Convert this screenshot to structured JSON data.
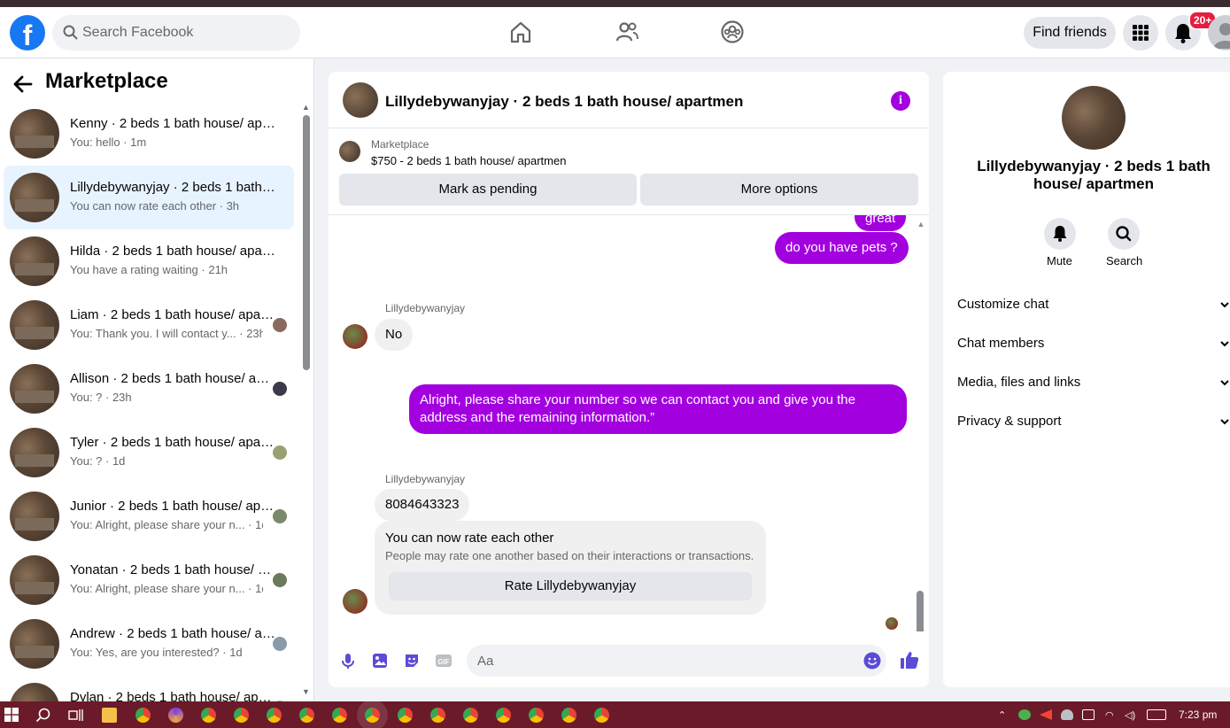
{
  "header": {
    "logo": "facebook-logo",
    "search_placeholder": "Search Facebook",
    "find_friends_label": "Find friends",
    "notification_count": "20+"
  },
  "sidebar": {
    "title": "Marketplace",
    "conversations": [
      {
        "title": "Kenny · 2 beds 1 bath house/ apartmen",
        "subtitle": "You: hello · 1m",
        "active": false,
        "avatar": false
      },
      {
        "title": "Lillydebywanyjay · 2 beds 1 bath house/ apartmen",
        "subtitle": "You can now rate each other · 3h",
        "active": true,
        "avatar": false
      },
      {
        "title": "Hilda · 2 beds 1 bath house/ apartmen",
        "subtitle": "You have a rating waiting · 21h",
        "active": false,
        "avatar": false
      },
      {
        "title": "Liam · 2 beds 1 bath house/ apartmen",
        "subtitle": "You: Thank you. I will contact y...  · 23h",
        "active": false,
        "avatar": true
      },
      {
        "title": "Allison · 2 beds 1 bath house/ apartmen",
        "subtitle": "You: ? · 23h",
        "active": false,
        "avatar": true
      },
      {
        "title": "Tyler · 2 beds 1 bath house/ apartmen",
        "subtitle": "You: ? · 1d",
        "active": false,
        "avatar": true
      },
      {
        "title": "Junior · 2 beds 1 bath house/ apartmen",
        "subtitle": "You: Alright, please share your n... · 1d",
        "active": false,
        "avatar": true
      },
      {
        "title": "Yonatan · 2 beds 1 bath house/ apartmen",
        "subtitle": "You: Alright, please share your n... · 1d",
        "active": false,
        "avatar": true
      },
      {
        "title": "Andrew · 2 beds 1 bath house/ apartmen",
        "subtitle": "You: Yes, are you interested? · 1d",
        "active": false,
        "avatar": true
      },
      {
        "title": "Dylan · 2 beds 1 bath house/ apartmen",
        "subtitle": "",
        "active": false,
        "avatar": true
      }
    ]
  },
  "chat": {
    "title": "Lillydebywanyjay · 2 beds 1 bath house/ apartmen",
    "marketplace_label": "Marketplace",
    "listing": "$750 - 2 beds 1 bath house/ apartmen",
    "mark_pending_label": "Mark as pending",
    "more_options_label": "More options",
    "messages": {
      "partial_out": "great",
      "pets_question": "do you have pets ?",
      "sender_name": "Lillydebywanyjay",
      "reply_no": "No",
      "share_number": "Alright, please share your number so we can contact you and give you the address and the remaining information.”",
      "phone_number": "8084643323"
    },
    "rate_card": {
      "title": "You can now rate each other",
      "description": "People may rate one another based on their interactions or transactions.",
      "button_label": "Rate Lillydebywanyjay"
    },
    "composer_placeholder": "Aa"
  },
  "right_panel": {
    "name": "Lillydebywanyjay · 2 beds 1 bath house/ apartmen",
    "mute_label": "Mute",
    "search_label": "Search",
    "sections": [
      "Customize chat",
      "Chat members",
      "Media, files and links",
      "Privacy & support"
    ]
  },
  "taskbar": {
    "time": "7:23 pm"
  },
  "colors": {
    "accent": "#a300e0",
    "facebook_blue": "#1877f2",
    "active_row": "#e7f3ff",
    "taskbar": "#6b1a2a"
  }
}
